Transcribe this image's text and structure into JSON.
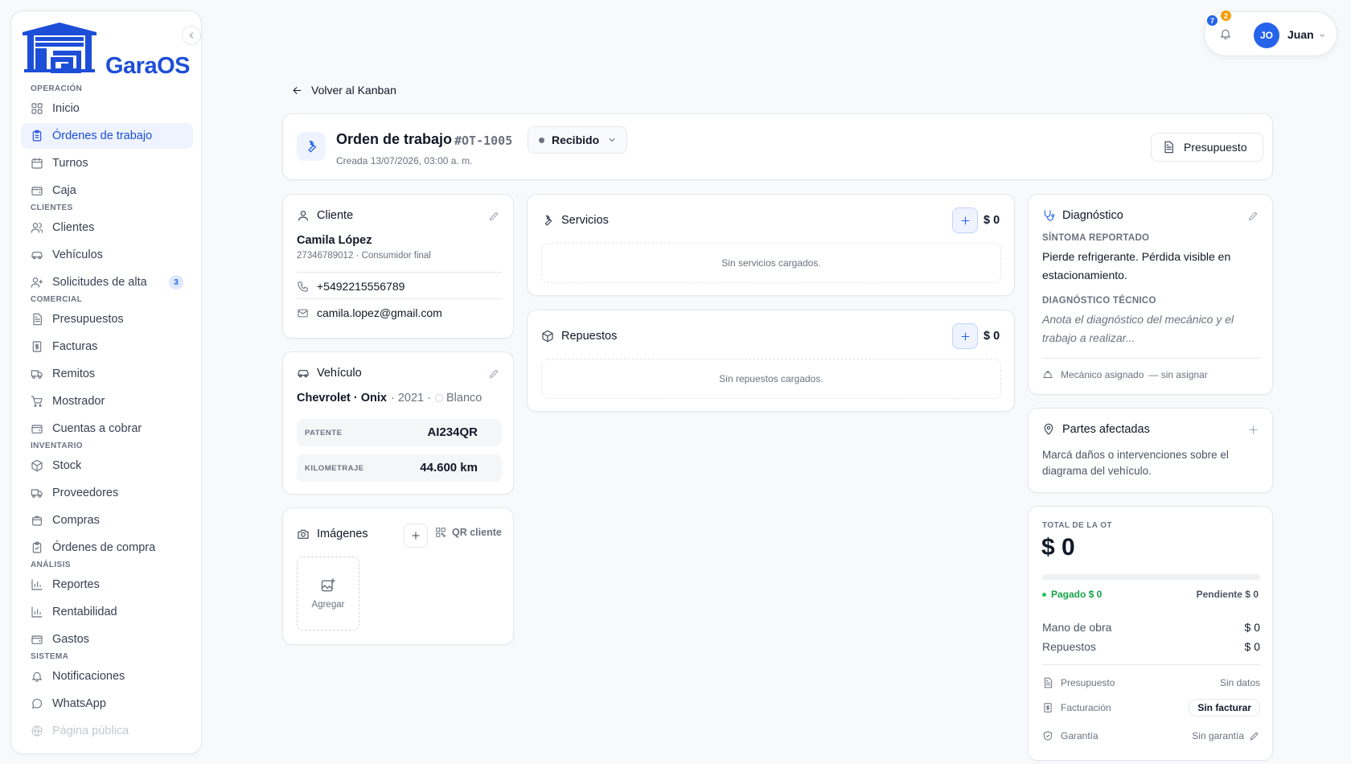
{
  "brand": {
    "name": "GaraOS",
    "color": "#1d4ed8"
  },
  "colors": {
    "accent": "#2563eb",
    "success": "#16a34a",
    "warning": "#f59e0b"
  },
  "sidebar": {
    "sections": [
      {
        "title": "OPERACIÓN",
        "items": [
          {
            "label": "Inicio",
            "icon": "grid-icon"
          },
          {
            "label": "Órdenes de trabajo",
            "icon": "clipboard-icon",
            "active": true
          },
          {
            "label": "Turnos",
            "icon": "calendar-icon"
          },
          {
            "label": "Caja",
            "icon": "wallet-icon"
          }
        ]
      },
      {
        "title": "CLIENTES",
        "items": [
          {
            "label": "Clientes",
            "icon": "users-icon"
          },
          {
            "label": "Vehículos",
            "icon": "car-icon"
          },
          {
            "label": "Solicitudes de alta",
            "icon": "user-plus-icon",
            "badge": "3"
          }
        ]
      },
      {
        "title": "COMERCIAL",
        "items": [
          {
            "label": "Presupuestos",
            "icon": "file-text-icon"
          },
          {
            "label": "Facturas",
            "icon": "invoice-icon"
          },
          {
            "label": "Remitos",
            "icon": "truck-icon"
          },
          {
            "label": "Mostrador",
            "icon": "cart-icon"
          },
          {
            "label": "Cuentas a cobrar",
            "icon": "wallet-icon"
          }
        ]
      },
      {
        "title": "INVENTARIO",
        "items": [
          {
            "label": "Stock",
            "icon": "box-icon"
          },
          {
            "label": "Proveedores",
            "icon": "truck-icon"
          },
          {
            "label": "Compras",
            "icon": "bag-icon"
          },
          {
            "label": "Órdenes de compra",
            "icon": "clipboard-icon"
          }
        ]
      },
      {
        "title": "ANÁLISIS",
        "items": [
          {
            "label": "Reportes",
            "icon": "bar-chart-icon"
          },
          {
            "label": "Rentabilidad",
            "icon": "bar-chart-icon"
          },
          {
            "label": "Gastos",
            "icon": "wallet-icon"
          }
        ]
      },
      {
        "title": "SISTEMA",
        "items": [
          {
            "label": "Notificaciones",
            "icon": "bell-icon"
          },
          {
            "label": "WhatsApp",
            "icon": "chat-icon"
          },
          {
            "label": "Página pública",
            "icon": "globe-icon"
          }
        ]
      }
    ]
  },
  "topbar": {
    "notif_blue": "7",
    "notif_orange": "2",
    "avatar_initials": "JO",
    "user_name": "Juan"
  },
  "back_link": "Volver al Kanban",
  "order": {
    "title": "Orden de trabajo",
    "code": "#OT-1005",
    "status": "Recibido",
    "created": "Creada 13/07/2026, 03:00 a. m.",
    "budget_button": "Presupuesto"
  },
  "client": {
    "title": "Cliente",
    "name": "Camila López",
    "sub": "27346789012 · Consumidor final",
    "phone": "+5492215556789",
    "email": "camila.lopez@gmail.com"
  },
  "vehicle": {
    "title": "Vehículo",
    "make_model": "Chevrolet · Onix",
    "year": "· 2021 ·",
    "color": "Blanco",
    "plate_label": "PATENTE",
    "plate": "AI234QR",
    "km_label": "KILOMETRAJE",
    "km": "44.600 km"
  },
  "images": {
    "title": "Imágenes",
    "qr_label": "QR cliente",
    "add_label": "Agregar"
  },
  "services": {
    "title": "Servicios",
    "amount": "$ 0",
    "empty": "Sin servicios cargados."
  },
  "parts": {
    "title": "Repuestos",
    "amount": "$ 0",
    "empty": "Sin repuestos cargados."
  },
  "diagnosis": {
    "title": "Diagnóstico",
    "symptom_label": "SÍNTOMA REPORTADO",
    "symptom": "Pierde refrigerante. Pérdida visible en estacionamiento.",
    "tech_label": "DIAGNÓSTICO TÉCNICO",
    "tech_placeholder": "Anota el diagnóstico del mecánico y el trabajo a realizar...",
    "mechanic_label": "Mecánico asignado",
    "mechanic_value": "— sin asignar"
  },
  "affected": {
    "title": "Partes afectadas",
    "text": "Marcá daños o intervenciones sobre el diagrama del vehículo."
  },
  "total": {
    "caption": "TOTAL DE LA OT",
    "amount": "$ 0",
    "paid_fraction": 0,
    "paid": "Pagado $ 0",
    "pending": "Pendiente $ 0",
    "labor_label": "Mano de obra",
    "labor": "$ 0",
    "parts_label": "Repuestos",
    "parts": "$ 0",
    "budget_label": "Presupuesto",
    "budget_value": "Sin datos",
    "billing_label": "Facturación",
    "billing_value": "Sin facturar",
    "warranty_label": "Garantía",
    "warranty_value": "Sin garantía"
  }
}
